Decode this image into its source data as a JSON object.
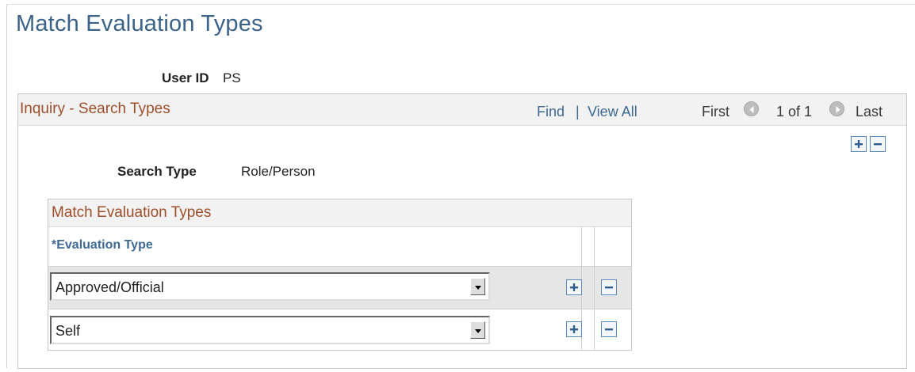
{
  "page": {
    "title": "Match Evaluation Types"
  },
  "user": {
    "label": "User ID",
    "value": "PS"
  },
  "scroll": {
    "title": "Inquiry - Search Types",
    "find": "Find",
    "separator": "|",
    "view_all": "View All",
    "first": "First",
    "counter": "1 of 1",
    "last": "Last"
  },
  "search_type": {
    "label": "Search Type",
    "value": "Role/Person"
  },
  "grid": {
    "title": "Match Evaluation Types",
    "column_header": "*Evaluation Type",
    "rows": [
      {
        "evaluation_type": "Approved/Official"
      },
      {
        "evaluation_type": "Self"
      }
    ]
  },
  "icons": {
    "add": "plus-icon",
    "delete": "minus-icon",
    "previous": "arrow-left-icon",
    "next": "arrow-right-icon",
    "dropdown": "chevron-down-icon"
  },
  "colors": {
    "title": "#3b6287",
    "section_title": "#9c4f2a",
    "link": "#3e6a92"
  }
}
